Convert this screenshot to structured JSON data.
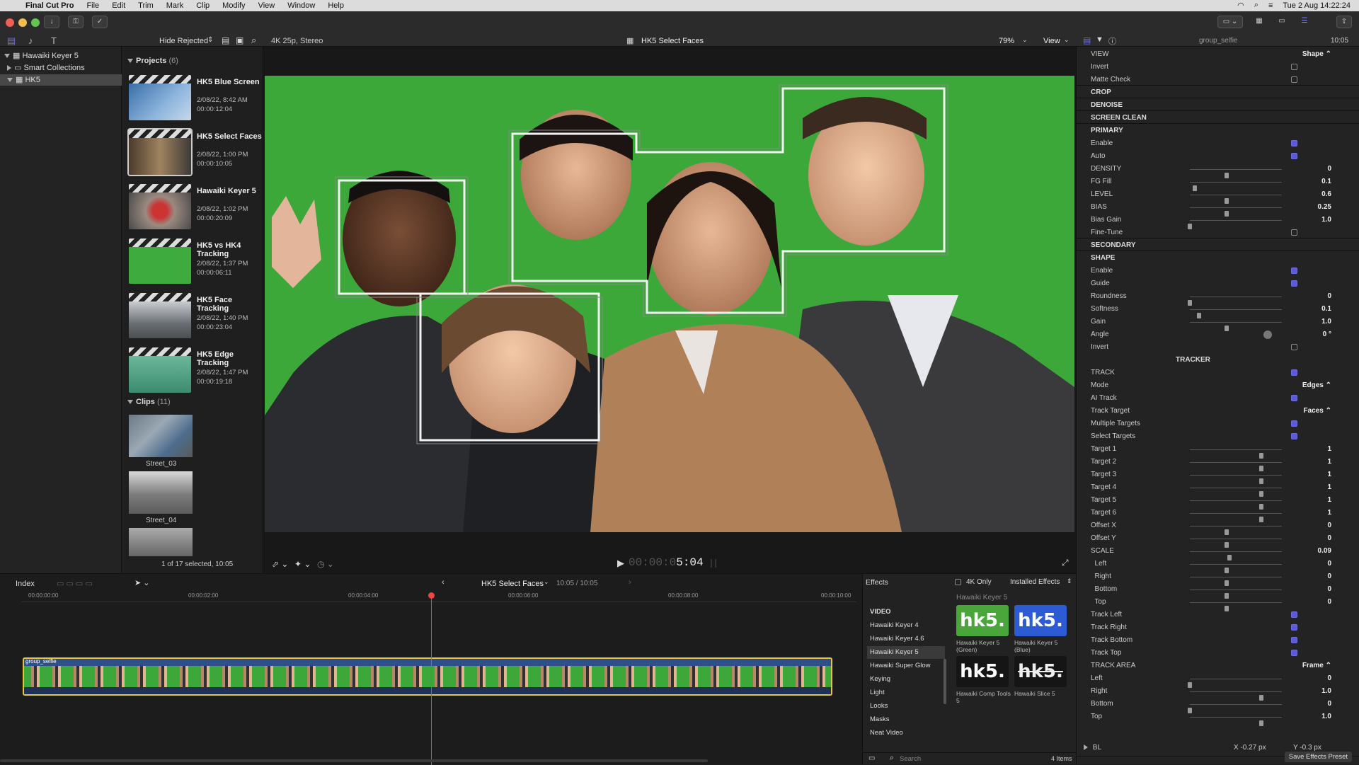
{
  "menubar": {
    "apple": "",
    "app": "Final Cut Pro",
    "menus": [
      "File",
      "Edit",
      "Trim",
      "Mark",
      "Clip",
      "Modify",
      "View",
      "Window",
      "Help"
    ],
    "clock": "Tue 2 Aug  14:22:24"
  },
  "toolbar": {
    "hide_rejected": "Hide Rejected",
    "format": "4K 25p, Stereo",
    "project_title": "HK5 Select Faces",
    "zoom": "79%",
    "view": "View",
    "inspector_clip": "group_selfie",
    "inspector_time": "10:05"
  },
  "library": {
    "root": "Hawaiki Keyer 5",
    "smart": "Smart Collections",
    "event": "HK5"
  },
  "browser": {
    "projects_label": "Projects",
    "projects_count": "(6)",
    "projects": [
      {
        "name": "HK5 Blue Screen",
        "date": "2/08/22, 8:42 AM",
        "dur": "00:00:12:04"
      },
      {
        "name": "HK5 Select Faces",
        "date": "2/08/22, 1:00 PM",
        "dur": "00:00:10:05"
      },
      {
        "name": "Hawaiki Keyer 5",
        "date": "2/08/22, 1:02 PM",
        "dur": "00:00:20:09"
      },
      {
        "name": "HK5 vs HK4 Tracking",
        "date": "2/08/22, 1:37 PM",
        "dur": "00:00:06:11"
      },
      {
        "name": "HK5 Face Tracking",
        "date": "2/08/22, 1:40 PM",
        "dur": "00:00:23:04"
      },
      {
        "name": "HK5 Edge Tracking",
        "date": "2/08/22, 1:47 PM",
        "dur": "00:00:19:18"
      }
    ],
    "clips_label": "Clips",
    "clips_count": "(11)",
    "clips": [
      "Street_03",
      "Street_04"
    ],
    "selection": "1 of 17 selected, 10:05"
  },
  "viewer": {
    "timecode_dim": "00:00:0",
    "timecode": "5:04"
  },
  "timeline": {
    "index": "Index",
    "project": "HK5 Select Faces",
    "time": "10:05 / 10:05",
    "ruler": [
      "00:00:00:00",
      "00:00:02:00",
      "00:00:04:00",
      "00:00:06:00",
      "00:00:08:00",
      "00:00:10:00"
    ],
    "clip": "group_selfie"
  },
  "effects": {
    "title": "Effects",
    "only4k": "4K Only",
    "installed": "Installed Effects",
    "categories": [
      "VIDEO",
      "Hawaiki Keyer 4",
      "Hawaiki Keyer 4.6",
      "Hawaiki Keyer 5",
      "Hawaiki Super Glow",
      "Keying",
      "Light",
      "Looks",
      "Masks",
      "Neat Video"
    ],
    "group": "Hawaiki Keyer 5",
    "tiles": [
      {
        "logo": "hk5.",
        "caption": "Hawaiki Keyer 5 (Green)"
      },
      {
        "logo": "hk5.",
        "caption": "Hawaiki Keyer 5 (Blue)"
      },
      {
        "logo": "hk5.",
        "caption": "Hawaiki Comp Tools 5"
      },
      {
        "logo": "hk5.",
        "caption": "Hawaiki Slice 5"
      }
    ],
    "search": "Search",
    "count": "4 Items"
  },
  "inspector": {
    "rows": [
      {
        "t": "row",
        "label": "VIEW",
        "value": "Shape ⌃"
      },
      {
        "t": "row",
        "label": "Invert",
        "check": false
      },
      {
        "t": "row",
        "label": "Matte Check",
        "check": false
      },
      {
        "t": "head",
        "label": "CROP"
      },
      {
        "t": "head",
        "label": "DENOISE"
      },
      {
        "t": "head",
        "label": "SCREEN CLEAN"
      },
      {
        "t": "head",
        "label": "PRIMARY"
      },
      {
        "t": "row",
        "label": "Enable",
        "check": true
      },
      {
        "t": "row",
        "label": "Auto",
        "check": true
      },
      {
        "t": "row",
        "label": "DENSITY",
        "value": "0",
        "knob": 0.4
      },
      {
        "t": "row",
        "label": "FG Fill",
        "value": "0.1",
        "knob": 0.05
      },
      {
        "t": "row",
        "label": "LEVEL",
        "value": "0.6",
        "knob": 0.4
      },
      {
        "t": "row",
        "label": "BIAS",
        "value": "0.25",
        "knob": 0.4
      },
      {
        "t": "row",
        "label": "Bias Gain",
        "value": "1.0",
        "knob": 0.0
      },
      {
        "t": "row",
        "label": "Fine-Tune",
        "check": false
      },
      {
        "t": "head",
        "label": "SECONDARY"
      },
      {
        "t": "head",
        "label": "SHAPE"
      },
      {
        "t": "row",
        "label": "Enable",
        "check": true
      },
      {
        "t": "row",
        "label": "Guide",
        "check": true
      },
      {
        "t": "row",
        "label": "Roundness",
        "value": "0",
        "knob": 0.0
      },
      {
        "t": "row",
        "label": "Softness",
        "value": "0.1",
        "knob": 0.1
      },
      {
        "t": "row",
        "label": "Gain",
        "value": "1.0",
        "knob": 0.4
      },
      {
        "t": "row",
        "label": "Angle",
        "value": "0 °",
        "dial": true
      },
      {
        "t": "row",
        "label": "Invert",
        "check": false
      },
      {
        "t": "center",
        "label": "TRACKER"
      },
      {
        "t": "row",
        "label": "TRACK",
        "check": true
      },
      {
        "t": "row",
        "label": "Mode",
        "value": "Edges ⌃"
      },
      {
        "t": "row",
        "label": "AI Track",
        "check": true
      },
      {
        "t": "row",
        "label": "Track Target",
        "value": "Faces ⌃"
      },
      {
        "t": "row",
        "label": "Multiple Targets",
        "check": true
      },
      {
        "t": "row",
        "label": "Select Targets",
        "check": true
      },
      {
        "t": "row",
        "label": "Target 1",
        "value": "1",
        "knob": 0.78
      },
      {
        "t": "row",
        "label": "Target 2",
        "value": "1",
        "knob": 0.78
      },
      {
        "t": "row",
        "label": "Target 3",
        "value": "1",
        "knob": 0.78
      },
      {
        "t": "row",
        "label": "Target 4",
        "value": "1",
        "knob": 0.78
      },
      {
        "t": "row",
        "label": "Target 5",
        "value": "1",
        "knob": 0.78
      },
      {
        "t": "row",
        "label": "Target 6",
        "value": "1",
        "knob": 0.78
      },
      {
        "t": "row",
        "label": "Offset X",
        "value": "0",
        "knob": 0.4
      },
      {
        "t": "row",
        "label": "Offset Y",
        "value": "0",
        "knob": 0.4
      },
      {
        "t": "row",
        "label": "SCALE",
        "value": "0.09",
        "knob": 0.43
      },
      {
        "t": "row",
        "label": "  Left",
        "value": "0",
        "knob": 0.4
      },
      {
        "t": "row",
        "label": "  Right",
        "value": "0",
        "knob": 0.4
      },
      {
        "t": "row",
        "label": "  Bottom",
        "value": "0",
        "knob": 0.4
      },
      {
        "t": "row",
        "label": "  Top",
        "value": "0",
        "knob": 0.4
      },
      {
        "t": "row",
        "label": "Track Left",
        "check": true
      },
      {
        "t": "row",
        "label": "Track Right",
        "check": true
      },
      {
        "t": "row",
        "label": "Track Bottom",
        "check": true
      },
      {
        "t": "row",
        "label": "Track Top",
        "check": true
      },
      {
        "t": "row",
        "label": "TRACK AREA",
        "value": "Frame ⌃"
      },
      {
        "t": "row",
        "label": "Left",
        "value": "0",
        "knob": 0.0
      },
      {
        "t": "row",
        "label": "Right",
        "value": "1.0",
        "knob": 0.78
      },
      {
        "t": "row",
        "label": "Bottom",
        "value": "0",
        "knob": 0.0
      },
      {
        "t": "row",
        "label": "Top",
        "value": "1.0",
        "knob": 0.78
      }
    ],
    "bl_label": "BL",
    "bl_x": "X   -0.27 px",
    "bl_y": "Y   -0.3 px",
    "save_preset": "Save Effects Preset"
  }
}
